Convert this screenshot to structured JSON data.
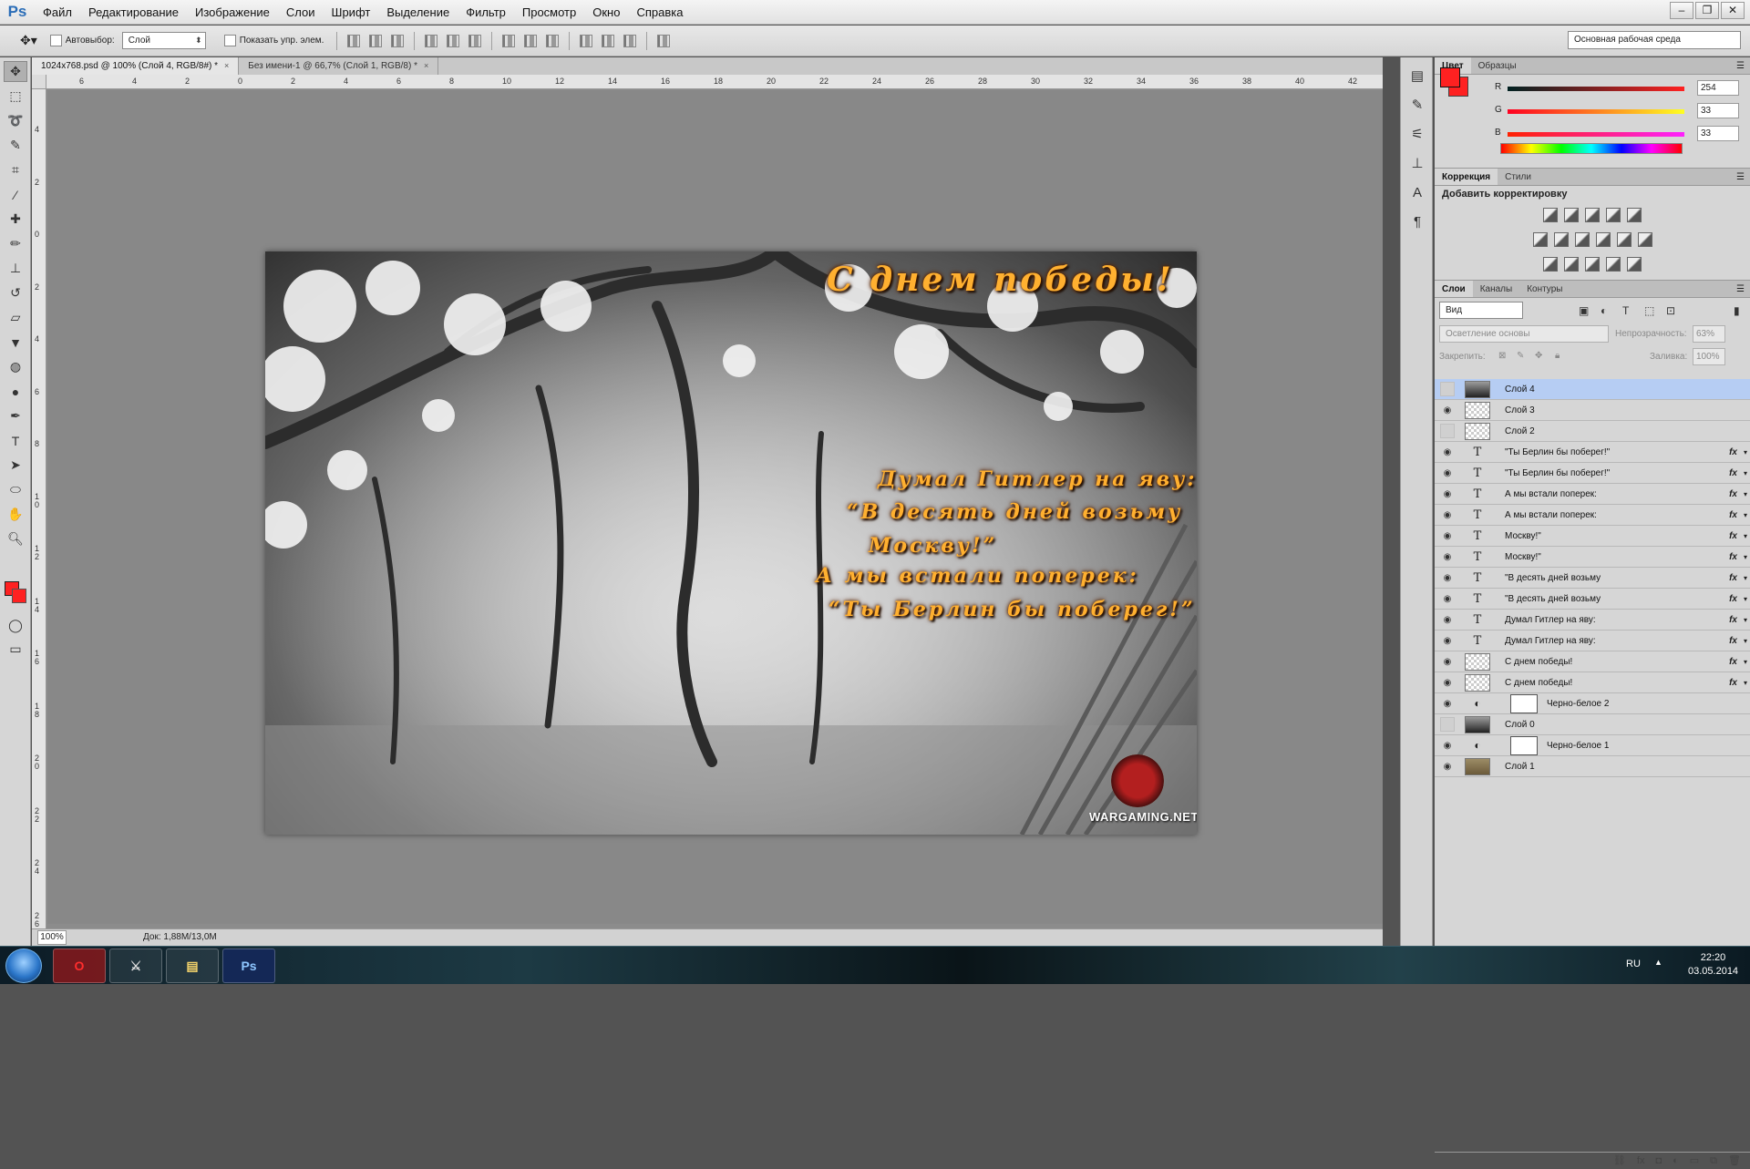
{
  "app": {
    "logo": "Ps"
  },
  "menu": [
    "Файл",
    "Редактирование",
    "Изображение",
    "Слои",
    "Шрифт",
    "Выделение",
    "Фильтр",
    "Просмотр",
    "Окно",
    "Справка"
  ],
  "window_controls": [
    "–",
    "❐",
    "✕"
  ],
  "options": {
    "autoselect_label": "Автовыбор:",
    "autoselect_value": "Слой",
    "show_controls_label": "Показать упр. элем.",
    "workspace": "Основная рабочая среда"
  },
  "tabs": [
    {
      "label": "1024x768.psd @ 100% (Слой 4, RGB/8#) *",
      "close": "×"
    },
    {
      "label": "Без имени-1 @ 66,7% (Слой 1, RGB/8) *",
      "close": "×"
    }
  ],
  "ruler_h": [
    "6",
    "4",
    "2",
    "0",
    "2",
    "4",
    "6",
    "8",
    "10",
    "12",
    "14",
    "16",
    "18",
    "20",
    "22",
    "24",
    "26",
    "28",
    "30",
    "32",
    "34",
    "36",
    "38",
    "40",
    "42"
  ],
  "ruler_v": [
    "4",
    "2",
    "0",
    "2",
    "4",
    "6",
    "8",
    "1\n0",
    "1\n2",
    "1\n4",
    "1\n6",
    "1\n8",
    "2\n0",
    "2\n2",
    "2\n4",
    "2\n6"
  ],
  "artwork": {
    "title": "С днем победы!",
    "poem": [
      "Думал Гитлер на яву:",
      "“В десять дней возьму",
      "Москву!”",
      "А мы встали поперек:",
      "“Ты Берлин бы поберег!”"
    ],
    "logo_text": "WARGAMING.NET"
  },
  "status": {
    "zoom": "100%",
    "doc_info": "Док: 1,88M/13,0M"
  },
  "color_panel": {
    "tabs": [
      "Цвет",
      "Образцы"
    ],
    "channels": [
      {
        "label": "R",
        "value": "254"
      },
      {
        "label": "G",
        "value": "33"
      },
      {
        "label": "B",
        "value": "33"
      }
    ],
    "fg": "#fe2121"
  },
  "correction_panel": {
    "tabs": [
      "Коррекция",
      "Стили"
    ],
    "title": "Добавить корректировку"
  },
  "layers_panel": {
    "tabs": [
      "Слои",
      "Каналы",
      "Контуры"
    ],
    "kind": "Вид",
    "blend_mode": "Осветление основы",
    "opacity_label": "Непрозрачность:",
    "opacity": "63%",
    "lock_label": "Закрепить:",
    "fill_label": "Заливка:",
    "fill": "100%",
    "layers": [
      {
        "name": "Слой 4",
        "kind": "dark",
        "visible": false,
        "selected": true,
        "fx": false
      },
      {
        "name": "Слой 3",
        "kind": "pixel",
        "visible": true,
        "fx": false
      },
      {
        "name": "Слой 2",
        "kind": "pixel",
        "visible": false,
        "fx": false
      },
      {
        "name": "\"Ты Берлин бы поберег!\"",
        "kind": "text",
        "visible": true,
        "fx": true
      },
      {
        "name": "\"Ты Берлин бы поберег!\"",
        "kind": "text",
        "visible": true,
        "fx": true
      },
      {
        "name": "А мы встали поперек:",
        "kind": "text",
        "visible": true,
        "fx": true
      },
      {
        "name": "А мы встали поперек:",
        "kind": "text",
        "visible": true,
        "fx": true
      },
      {
        "name": "Москву!\"",
        "kind": "text",
        "visible": true,
        "fx": true
      },
      {
        "name": "Москву!\"",
        "kind": "text",
        "visible": true,
        "fx": true
      },
      {
        "name": "\"В десять дней возьму",
        "kind": "text",
        "visible": true,
        "fx": true
      },
      {
        "name": "\"В десять дней возьму",
        "kind": "text",
        "visible": true,
        "fx": true
      },
      {
        "name": "Думал Гитлер на яву:",
        "kind": "text",
        "visible": true,
        "fx": true
      },
      {
        "name": "Думал Гитлер на яву:",
        "kind": "text",
        "visible": true,
        "fx": true
      },
      {
        "name": "С днем победы!",
        "kind": "pixel",
        "visible": true,
        "fx": true
      },
      {
        "name": "С днем победы!",
        "kind": "pixel",
        "visible": true,
        "fx": true
      },
      {
        "name": "Черно-белое 2",
        "kind": "adjustment",
        "visible": true,
        "fx": false
      },
      {
        "name": "Слой 0",
        "kind": "dark",
        "visible": false,
        "fx": false
      },
      {
        "name": "Черно-белое 1",
        "kind": "adjustment",
        "visible": true,
        "fx": false
      },
      {
        "name": "Слой 1",
        "kind": "photo",
        "visible": true,
        "fx": false
      }
    ],
    "fx_label": "fx",
    "eye_glyph": "◉"
  },
  "taskbar": {
    "apps": [
      "O",
      "⚔",
      "▤",
      "Ps"
    ],
    "lang": "RU",
    "time": "22:20",
    "date": "03.05.2014"
  }
}
